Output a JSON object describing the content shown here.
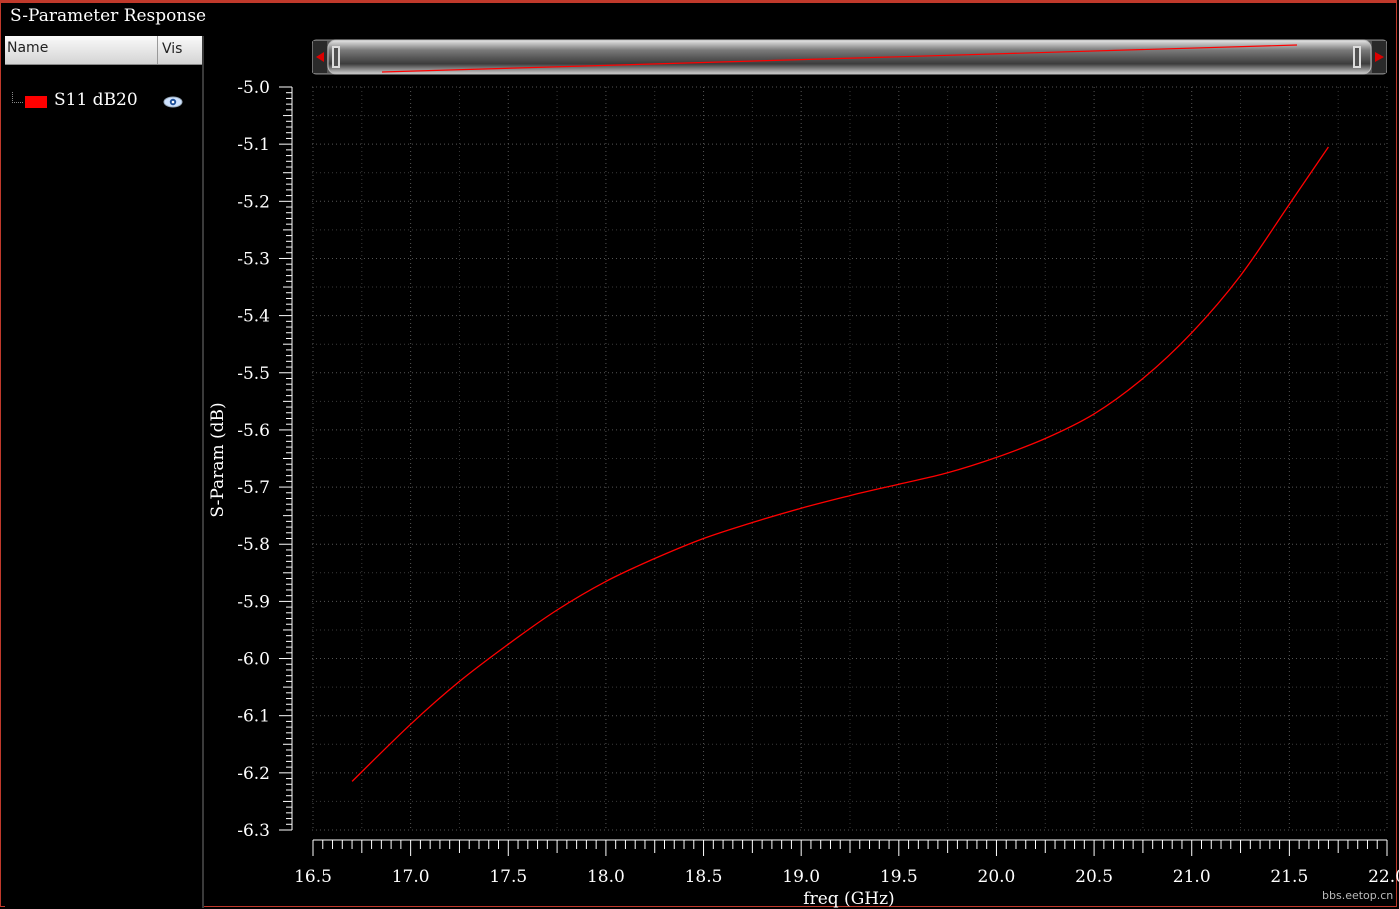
{
  "window": {
    "title": "S-Parameter Response"
  },
  "legend": {
    "header_name": "Name",
    "header_vis": "Vis",
    "items": [
      {
        "label": "S11 dB20",
        "color": "#ff0000",
        "icon": "eye-icon"
      }
    ]
  },
  "watermark": "bbs.eetop.cn",
  "chart_data": {
    "type": "line",
    "xlabel": "freq (GHz)",
    "ylabel": "S-Param (dB)",
    "xlim": [
      16.5,
      22.0
    ],
    "ylim": [
      -6.3,
      -5.0
    ],
    "xticks": [
      "16.5",
      "17.0",
      "17.5",
      "18.0",
      "18.5",
      "19.0",
      "19.5",
      "20.0",
      "20.5",
      "21.0",
      "21.5",
      "22.0"
    ],
    "yticks": [
      "-5.0",
      "-5.1",
      "-5.2",
      "-5.3",
      "-5.4",
      "-5.5",
      "-5.6",
      "-5.7",
      "-5.8",
      "-5.9",
      "-6.0",
      "-6.1",
      "-6.2",
      "-6.3"
    ],
    "grid": true,
    "background": "#000000",
    "series": [
      {
        "name": "S11 dB20",
        "color": "#ff0000",
        "x": [
          16.7,
          17.0,
          17.25,
          17.5,
          17.75,
          18.0,
          18.25,
          18.5,
          18.75,
          19.0,
          19.25,
          19.5,
          19.75,
          20.0,
          20.25,
          20.5,
          20.75,
          21.0,
          21.25,
          21.5,
          21.7
        ],
        "y": [
          -6.215,
          -6.115,
          -6.04,
          -5.975,
          -5.915,
          -5.865,
          -5.825,
          -5.79,
          -5.762,
          -5.737,
          -5.715,
          -5.695,
          -5.675,
          -5.648,
          -5.615,
          -5.572,
          -5.51,
          -5.43,
          -5.33,
          -5.205,
          -5.105
        ]
      }
    ]
  }
}
